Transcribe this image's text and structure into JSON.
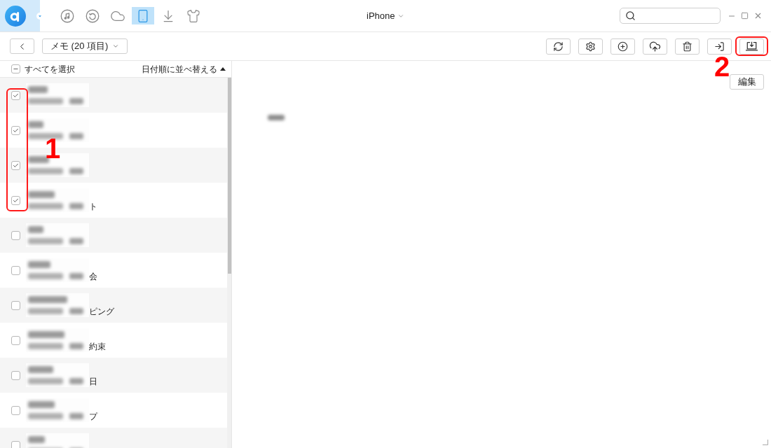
{
  "app": {
    "title": "iPhone"
  },
  "nav": [
    {
      "kind": "music",
      "selected": false
    },
    {
      "kind": "history",
      "selected": false
    },
    {
      "kind": "cloud",
      "selected": false
    },
    {
      "kind": "device",
      "selected": true
    },
    {
      "kind": "download",
      "selected": false
    },
    {
      "kind": "shirt",
      "selected": false
    }
  ],
  "toolbar": {
    "category": "メモ (20 項目)",
    "actions": [
      {
        "kind": "refresh"
      },
      {
        "kind": "settings"
      },
      {
        "kind": "add"
      },
      {
        "kind": "upload"
      },
      {
        "kind": "delete"
      },
      {
        "kind": "to-device"
      },
      {
        "kind": "to-computer"
      }
    ]
  },
  "list": {
    "select_all": {
      "label": "すべてを選択",
      "indeterminate": true
    },
    "sort": {
      "label": "日付順に並べ替える",
      "ascending": true
    },
    "rows": [
      {
        "checked": true
      },
      {
        "checked": true
      },
      {
        "checked": true
      },
      {
        "checked": true,
        "visible_text": "ト"
      },
      {
        "checked": false
      },
      {
        "checked": false,
        "visible_text": "会"
      },
      {
        "checked": false,
        "visible_text": "ピング"
      },
      {
        "checked": false,
        "visible_text": "約束"
      },
      {
        "checked": false,
        "visible_text": "日"
      },
      {
        "checked": false,
        "visible_text": "プ"
      },
      {
        "checked": false
      }
    ]
  },
  "detail": {
    "edit_button": "編集"
  },
  "annotations": [
    {
      "label": "1"
    },
    {
      "label": "2"
    }
  ]
}
